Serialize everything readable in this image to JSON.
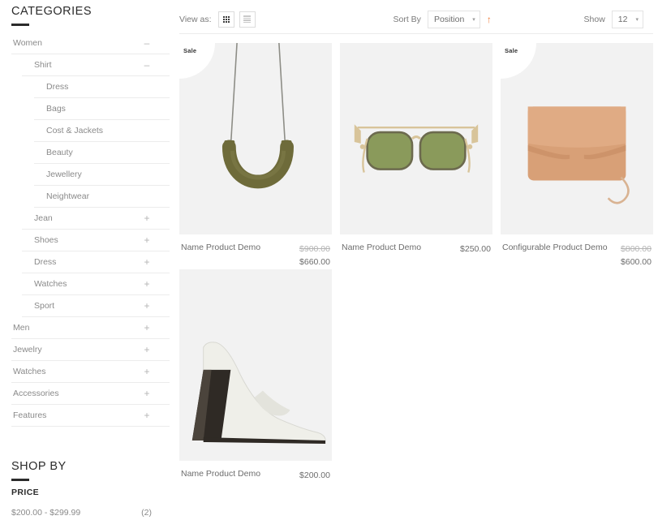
{
  "sidebar": {
    "categories_heading": "CATEGORIES",
    "categories": [
      {
        "label": "Women",
        "level": 0,
        "toggle": "–"
      },
      {
        "label": "Shirt",
        "level": 1,
        "toggle": "–"
      },
      {
        "label": "Dress",
        "level": 2,
        "toggle": ""
      },
      {
        "label": "Bags",
        "level": 2,
        "toggle": ""
      },
      {
        "label": "Cost & Jackets",
        "level": 2,
        "toggle": ""
      },
      {
        "label": "Beauty",
        "level": 2,
        "toggle": ""
      },
      {
        "label": "Jewellery",
        "level": 2,
        "toggle": ""
      },
      {
        "label": "Neightwear",
        "level": 2,
        "toggle": ""
      },
      {
        "label": "Jean",
        "level": 1,
        "toggle": "+"
      },
      {
        "label": "Shoes",
        "level": 1,
        "toggle": "+"
      },
      {
        "label": "Dress",
        "level": 1,
        "toggle": "+"
      },
      {
        "label": "Watches",
        "level": 1,
        "toggle": "+"
      },
      {
        "label": "Sport",
        "level": 1,
        "toggle": "+"
      },
      {
        "label": "Men",
        "level": 0,
        "toggle": "+"
      },
      {
        "label": "Jewelry",
        "level": 0,
        "toggle": "+"
      },
      {
        "label": "Watches",
        "level": 0,
        "toggle": "+"
      },
      {
        "label": "Accessories",
        "level": 0,
        "toggle": "+"
      },
      {
        "label": "Features",
        "level": 0,
        "toggle": "+"
      }
    ],
    "shop_by_heading": "SHOP BY",
    "price_filter_title": "PRICE",
    "price_filters": [
      {
        "range": "$200.00 - $299.99",
        "count": "(2)"
      }
    ]
  },
  "toolbar": {
    "view_as_label": "View as:",
    "grid_icon": "grid-view-icon",
    "list_icon": "list-view-icon",
    "sort_by_label": "Sort By",
    "sort_value": "Position",
    "sort_caret": "▾",
    "sort_direction_icon": "↑",
    "sort_direction_color": "#ef7b38",
    "show_label": "Show",
    "show_value": "12",
    "show_caret": "▾"
  },
  "products": [
    {
      "name": "Name Product Demo",
      "badge": "Sale",
      "old_price": "$900.00",
      "price": "$660.00",
      "art": "necklace"
    },
    {
      "name": "Name Product Demo",
      "badge": "",
      "old_price": "",
      "price": "$250.00",
      "art": "sunglasses"
    },
    {
      "name": "Configurable Product Demo",
      "badge": "Sale",
      "old_price": "$800.00",
      "price": "$600.00",
      "art": "handbag"
    },
    {
      "name": "Name Product Demo",
      "badge": "",
      "old_price": "",
      "price": "$200.00",
      "art": "shoe"
    }
  ],
  "colors": {
    "accent": "#ef7b38",
    "thumb_bg": "#f2f2f2",
    "text": "#6d6d6d",
    "heading": "#2b2b2b",
    "necklace": "#6e6b3a",
    "lens": "#8a9a5b",
    "frame": "#d8c49a",
    "bag": "#d8a077",
    "shoe": "#efefe9",
    "heel": "#2f2a25"
  }
}
